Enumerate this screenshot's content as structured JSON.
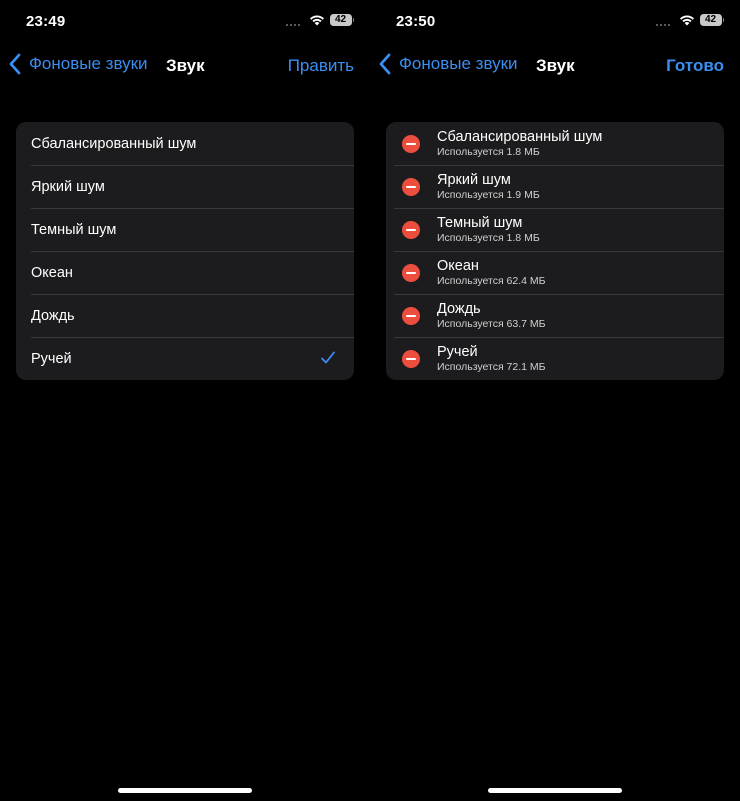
{
  "left": {
    "status": {
      "time": "23:49",
      "battery": "42"
    },
    "nav": {
      "back_label": "Фоновые звуки",
      "title": "Звук",
      "action": "Править"
    },
    "sounds": [
      {
        "label": "Сбалансированный шум"
      },
      {
        "label": "Яркий шум"
      },
      {
        "label": "Темный шум"
      },
      {
        "label": "Океан"
      },
      {
        "label": "Дождь"
      },
      {
        "label": "Ручей",
        "selected": true
      }
    ]
  },
  "right": {
    "status": {
      "time": "23:50",
      "battery": "42"
    },
    "nav": {
      "back_label": "Фоновые звуки",
      "title": "Звук",
      "action": "Готово"
    },
    "sounds": [
      {
        "label": "Сбалансированный шум",
        "size": "Используется 1.8 МБ"
      },
      {
        "label": "Яркий шум",
        "size": "Используется 1.9 МБ"
      },
      {
        "label": "Темный шум",
        "size": "Используется 1.8 МБ"
      },
      {
        "label": "Океан",
        "size": "Используется 62.4 МБ"
      },
      {
        "label": "Дождь",
        "size": "Используется 63.7 МБ"
      },
      {
        "label": "Ручей",
        "size": "Используется 72.1 МБ"
      }
    ]
  },
  "colors": {
    "accent": "#3b8ef0",
    "delete": "#eb4e3d",
    "cell": "#1c1c1e",
    "background": "#000000"
  },
  "icons": {
    "back": "chevron-left-icon",
    "check": "checkmark-icon",
    "delete": "minus-circle-icon",
    "wifi": "wifi-icon",
    "signal": "signal-icon",
    "battery": "battery-icon"
  }
}
